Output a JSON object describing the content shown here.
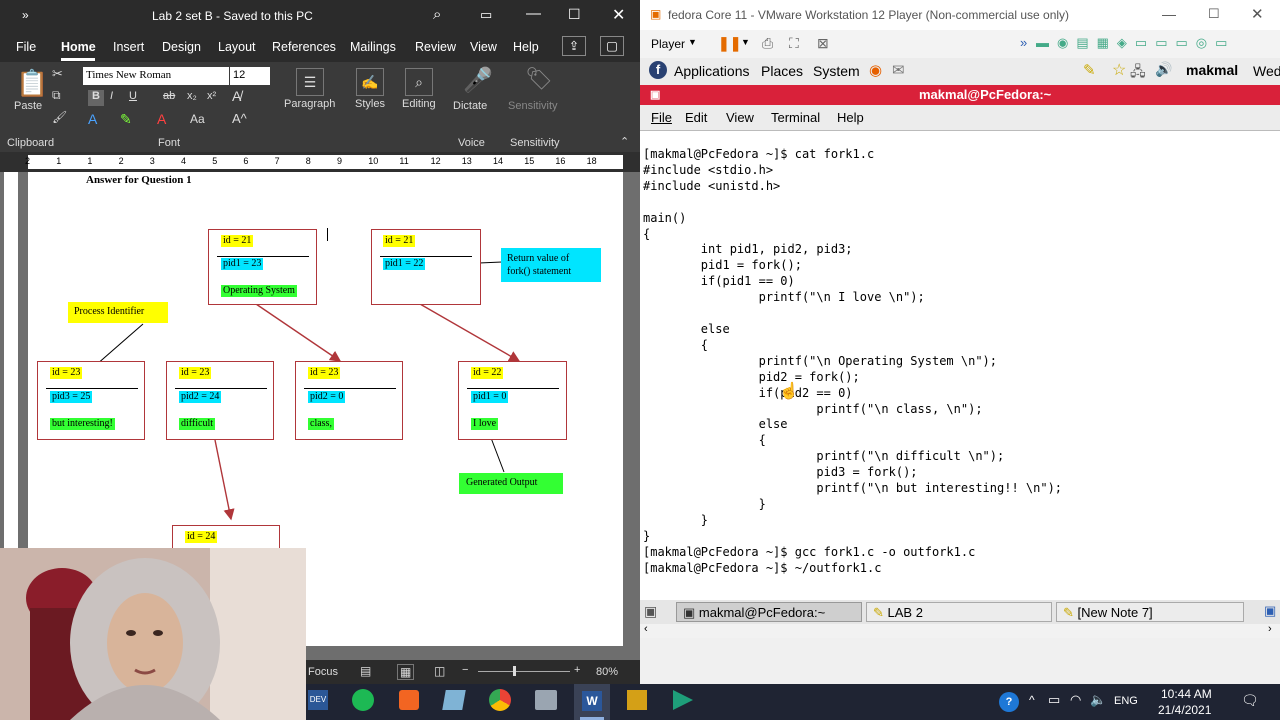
{
  "word": {
    "title": "Lab 2 set B  -  Saved to this PC",
    "tabs": [
      "File",
      "Home",
      "Insert",
      "Design",
      "Layout",
      "References",
      "Mailings",
      "Review",
      "View",
      "Help"
    ],
    "ribbon": {
      "paste": "Paste",
      "font_name": "Times New Roman",
      "font_size": "12",
      "paragraph": "Paragraph",
      "styles": "Styles",
      "editing": "Editing",
      "dictate": "Dictate",
      "sensitivity": "Sensitivity",
      "groups": [
        "Clipboard",
        "Font",
        "Voice",
        "Sensitivity"
      ]
    },
    "ruler_numbers": [
      "2",
      "1",
      "1",
      "2",
      "3",
      "4",
      "5",
      "6",
      "7",
      "8",
      "9",
      "10",
      "11",
      "12",
      "13",
      "14",
      "15",
      "16",
      "18"
    ],
    "doc": {
      "heading": "Answer for Question 1",
      "process_identifier": "Process Identifier",
      "return_value_label": "Return value of fork() statement",
      "generated_output": "Generated Output",
      "boxes": [
        {
          "id": "id = 21",
          "pid": "pid1 = 23",
          "out": "Operating System"
        },
        {
          "id": "id = 21",
          "pid": "pid1 = 22",
          "out": ""
        },
        {
          "id": "id = 23",
          "pid": "pid3 = 25",
          "out": "but interesting!"
        },
        {
          "id": "id = 23",
          "pid": "pid2 = 24",
          "out": "difficult"
        },
        {
          "id": "id = 23",
          "pid": "pid2 = 0",
          "out": "class,"
        },
        {
          "id": "id = 22",
          "pid": "pid1 = 0",
          "out": "I love"
        },
        {
          "id": "id = 24",
          "pid": "",
          "out": ""
        }
      ]
    },
    "status": {
      "focus": "Focus",
      "zoom": "80%"
    }
  },
  "vmware": {
    "title": "fedora Core 11 - VMware Workstation 12 Player (Non-commercial use only)",
    "player_label": "Player",
    "gnome_menu": [
      "Applications",
      "Places",
      "System"
    ],
    "user": "makmal",
    "day": "Wed",
    "terminal_title": "makmal@PcFedora:~",
    "terminal_menu": [
      "File",
      "Edit",
      "View",
      "Terminal",
      "Help"
    ],
    "terminal_lines": [
      "[makmal@PcFedora ~]$ cat fork1.c",
      "#include <stdio.h>",
      "#include <unistd.h>",
      "",
      "main()",
      "{",
      "        int pid1, pid2, pid3;",
      "        pid1 = fork();",
      "        if(pid1 == 0)",
      "                printf(\"\\n I love \\n\");",
      "",
      "        else",
      "        {",
      "                printf(\"\\n Operating System \\n\");",
      "                pid2 = fork();",
      "                if(pid2 == 0)",
      "                        printf(\"\\n class, \\n\");",
      "                else",
      "                {",
      "                        printf(\"\\n difficult \\n\");",
      "                        pid3 = fork();",
      "                        printf(\"\\n but interesting!! \\n\");",
      "                }",
      "        }",
      "}",
      "[makmal@PcFedora ~]$ gcc fork1.c -o outfork1.c",
      "[makmal@PcFedora ~]$ ~/outfork1.c"
    ],
    "tasks": [
      "makmal@PcFedora:~",
      "LAB 2",
      "[New Note 7]"
    ]
  },
  "taskbar": {
    "lang": "ENG",
    "time": "10:44 AM",
    "date": "21/4/2021"
  },
  "colors": {
    "accent_word": "#2b579a",
    "terminal_title": "#d9213a",
    "box_border": "#b0363a",
    "arrow": "#b0363a"
  }
}
